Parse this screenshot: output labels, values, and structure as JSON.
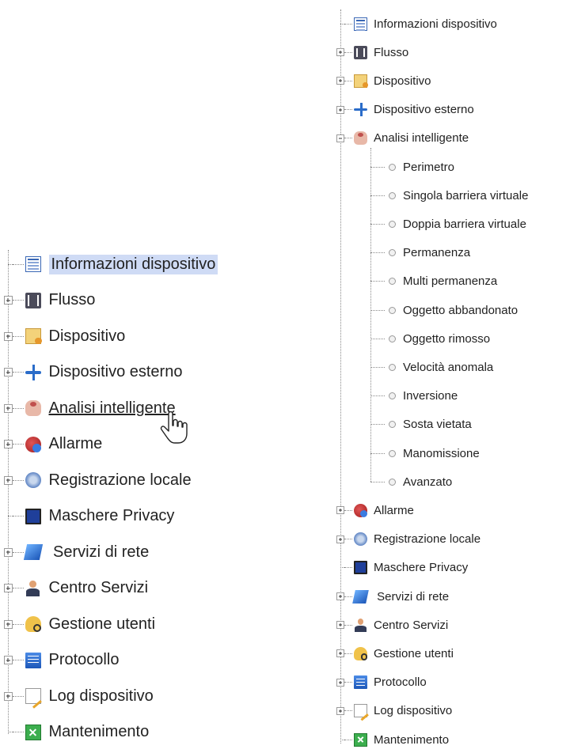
{
  "left_tree": {
    "items": [
      {
        "icon": "device-info-icon",
        "label": "Informazioni dispositivo",
        "selected": true
      },
      {
        "icon": "stream-icon",
        "label": "Flusso"
      },
      {
        "icon": "device-icon",
        "label": "Dispositivo"
      },
      {
        "icon": "external-device-icon",
        "label": "Dispositivo esterno"
      },
      {
        "icon": "smart-analysis-icon",
        "label": "Analisi intelligente",
        "hovered": true
      },
      {
        "icon": "alarm-icon",
        "label": "Allarme"
      },
      {
        "icon": "local-recording-icon",
        "label": "Registrazione locale"
      },
      {
        "icon": "privacy-mask-icon",
        "label": "Maschere Privacy"
      },
      {
        "icon": "network-services-icon",
        "label": " Servizi di rete"
      },
      {
        "icon": "service-center-icon",
        "label": "Centro Servizi"
      },
      {
        "icon": "user-management-icon",
        "label": "Gestione utenti"
      },
      {
        "icon": "protocol-icon",
        "label": "Protocollo"
      },
      {
        "icon": "device-log-icon",
        "label": "Log dispositivo"
      },
      {
        "icon": "maintenance-icon",
        "label": "Mantenimento"
      }
    ]
  },
  "right_tree": {
    "items": [
      {
        "icon": "device-info-icon",
        "label": "Informazioni dispositivo"
      },
      {
        "icon": "stream-icon",
        "label": "Flusso"
      },
      {
        "icon": "device-icon",
        "label": "Dispositivo"
      },
      {
        "icon": "external-device-icon",
        "label": "Dispositivo esterno"
      },
      {
        "icon": "smart-analysis-icon",
        "label": "Analisi intelligente",
        "expanded": true
      },
      {
        "icon": "alarm-icon",
        "label": "Allarme"
      },
      {
        "icon": "local-recording-icon",
        "label": "Registrazione locale"
      },
      {
        "icon": "privacy-mask-icon",
        "label": "Maschere Privacy"
      },
      {
        "icon": "network-services-icon",
        "label": " Servizi di rete"
      },
      {
        "icon": "service-center-icon",
        "label": "Centro Servizi"
      },
      {
        "icon": "user-management-icon",
        "label": "Gestione utenti"
      },
      {
        "icon": "protocol-icon",
        "label": "Protocollo"
      },
      {
        "icon": "device-log-icon",
        "label": "Log dispositivo"
      },
      {
        "icon": "maintenance-icon",
        "label": "Mantenimento"
      }
    ],
    "analysis_children": [
      "Perimetro",
      "Singola barriera virtuale",
      "Doppia barriera virtuale",
      "Permanenza",
      "Multi permanenza",
      "Oggetto abbandonato",
      "Oggetto rimosso",
      "Velocità anomala",
      "Inversione",
      "Sosta vietata",
      "Manomissione",
      "Avanzato"
    ]
  },
  "colors": {
    "selection": "#cfdbf5",
    "connector": "#8a8a8a",
    "text": "#222222"
  }
}
